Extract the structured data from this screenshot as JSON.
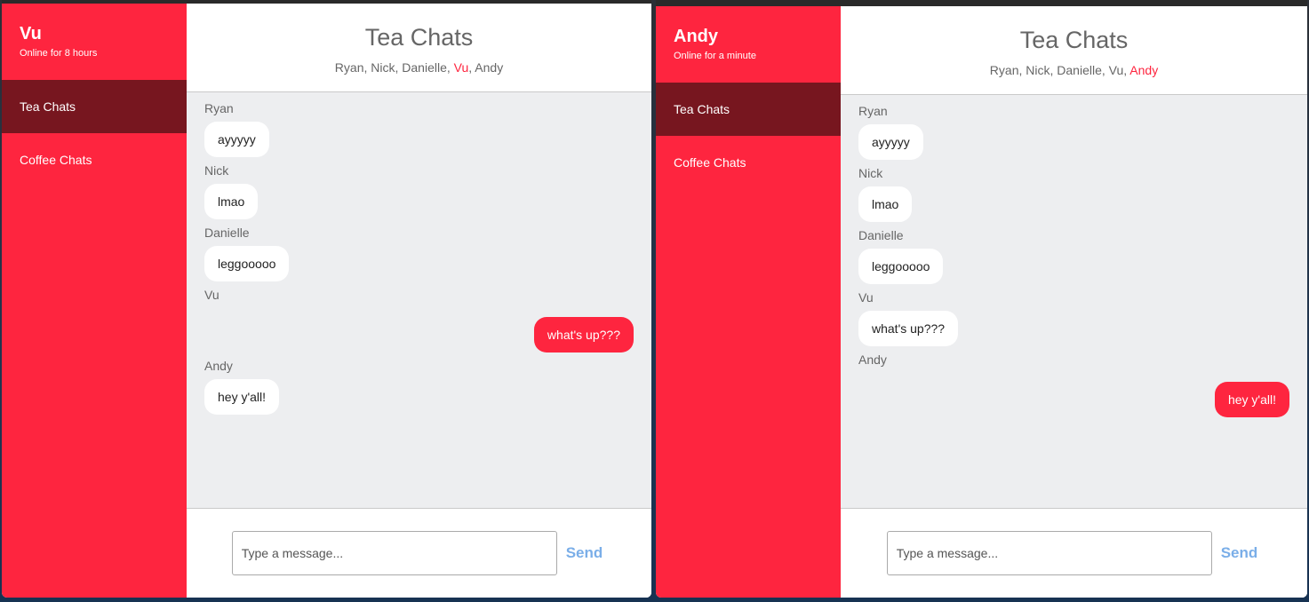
{
  "windows": [
    {
      "user": {
        "name": "Vu",
        "status": "Online for 8 hours"
      },
      "rooms": [
        {
          "label": "Tea Chats",
          "active": true
        },
        {
          "label": "Coffee Chats",
          "active": false
        }
      ],
      "header": {
        "title": "Tea Chats",
        "members": [
          "Ryan",
          "Nick",
          "Danielle",
          "Vu",
          "Andy"
        ],
        "separator": ", "
      },
      "messages": [
        {
          "sender": "Ryan",
          "text": "ayyyyy",
          "mine": false
        },
        {
          "sender": "Nick",
          "text": "lmao",
          "mine": false
        },
        {
          "sender": "Danielle",
          "text": "leggooooo",
          "mine": false
        },
        {
          "sender": "Vu",
          "text": "what's up???",
          "mine": true
        },
        {
          "sender": "Andy",
          "text": "hey y'all!",
          "mine": false
        }
      ],
      "composer": {
        "placeholder": "Type a message...",
        "send_label": "Send"
      }
    },
    {
      "user": {
        "name": "Andy",
        "status": "Online for a minute"
      },
      "rooms": [
        {
          "label": "Tea Chats",
          "active": true
        },
        {
          "label": "Coffee Chats",
          "active": false
        }
      ],
      "header": {
        "title": "Tea Chats",
        "members": [
          "Ryan",
          "Nick",
          "Danielle",
          "Vu",
          "Andy"
        ],
        "separator": ", "
      },
      "messages": [
        {
          "sender": "Ryan",
          "text": "ayyyyy",
          "mine": false
        },
        {
          "sender": "Nick",
          "text": "lmao",
          "mine": false
        },
        {
          "sender": "Danielle",
          "text": "leggooooo",
          "mine": false
        },
        {
          "sender": "Vu",
          "text": "what's up???",
          "mine": false
        },
        {
          "sender": "Andy",
          "text": "hey y'all!",
          "mine": true
        }
      ],
      "composer": {
        "placeholder": "Type a message...",
        "send_label": "Send"
      }
    }
  ],
  "colors": {
    "accent": "#fe253f",
    "active_room": "#77161f",
    "send": "#7aaee8",
    "messages_bg": "#edeef0"
  }
}
